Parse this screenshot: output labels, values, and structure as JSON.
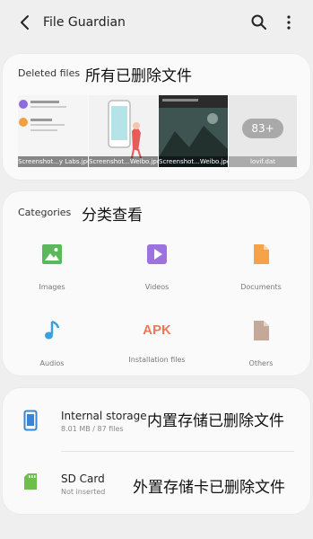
{
  "header": {
    "title": "File Guardian"
  },
  "deleted_files": {
    "label": "Deleted files",
    "annotation": "所有已删除文件",
    "thumbnails": [
      {
        "caption": "Screenshot...y Labs.jpg"
      },
      {
        "caption": "Screenshot...Weibo.jpg"
      },
      {
        "caption": "Screenshot...Weibo.jpg"
      },
      {
        "caption": "lovif.dat",
        "badge": "83+"
      }
    ]
  },
  "categories": {
    "label": "Categories",
    "annotation": "分类查看",
    "items": [
      {
        "label": "Images",
        "icon": "image-icon",
        "color": "#5cb85c"
      },
      {
        "label": "Videos",
        "icon": "video-icon",
        "color": "#9b72e0"
      },
      {
        "label": "Documents",
        "icon": "document-icon",
        "color": "#f5a24b"
      },
      {
        "label": "Audios",
        "icon": "music-note-icon",
        "color": "#3aa0e0"
      },
      {
        "label": "Installation files",
        "icon": "apk-icon",
        "icon_text": "APK",
        "color": "#f0775a"
      },
      {
        "label": "Others",
        "icon": "file-icon",
        "color": "#c4a898"
      }
    ]
  },
  "storage": {
    "internal": {
      "title": "Internal storage",
      "subtitle": "8.01 MB / 87 files",
      "annotation": "内置存储已删除文件",
      "icon": "phone-icon",
      "color": "#3a84d8"
    },
    "sd": {
      "title": "SD Card",
      "subtitle": "Not inserted",
      "annotation": "外置存储卡已删除文件",
      "icon": "sd-card-icon",
      "color": "#6cbf4b"
    }
  }
}
